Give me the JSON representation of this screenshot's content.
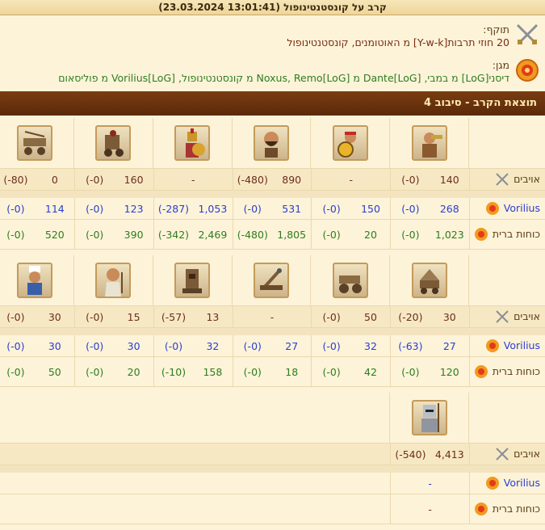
{
  "header": {
    "title": "קרב על קונסטנטינופול (13:01:41 23.03.2024)"
  },
  "attacker": {
    "role": "תוקף:",
    "text": "20 חוזי תרבות[Y-w-k] מ האוטומנים, קונסטנטינופול"
  },
  "defender": {
    "role": "מגן:",
    "text": "דיסני[LoG] מ במבי, Dante[LoG] מ Noxus, Remo[LoG] מ קונסטנטינופול, Vorilius[LoG] מ פוליסאום"
  },
  "section": {
    "title": "תוצאת הקרב - סיבוב 4"
  },
  "labels": {
    "enemies": "אויבים",
    "vorilius": "Vorilius",
    "allies": "כוחות ברית"
  },
  "icons": {
    "attacker": "crossed-swords-icon",
    "defender": "shield-emblem-icon",
    "enemy": "crossed-swords-icon",
    "ally": "shield-emblem-icon"
  },
  "colors": {
    "enemy_text": "#6b2e1c",
    "vorilius_text": "#2b3ed0",
    "ally_text": "#2e7d1e",
    "section_bar": "#6a3310"
  },
  "groups": [
    {
      "units": [
        {
          "name": "horn-soldier",
          "enemy": [
            "140",
            "(0-)"
          ],
          "vorilius": [
            "268",
            "(0-)"
          ],
          "allies": [
            "1,023",
            "(0-)"
          ]
        },
        {
          "name": "shield-warrior",
          "enemy": [
            "-"
          ],
          "vorilius": [
            "150",
            "(0-)"
          ],
          "allies": [
            "20",
            "(0-)"
          ]
        },
        {
          "name": "bearded-warrior",
          "enemy": [
            "890",
            "(480-)"
          ],
          "vorilius": [
            "531",
            "(0-)"
          ],
          "allies": [
            "1,805",
            "(480-)"
          ]
        },
        {
          "name": "spartan-hoplite",
          "enemy": [
            "-"
          ],
          "vorilius": [
            "1,053",
            "(287-)"
          ],
          "allies": [
            "2,469",
            "(342-)"
          ]
        },
        {
          "name": "armored-war-cart",
          "enemy": [
            "160",
            "(0-)"
          ],
          "vorilius": [
            "123",
            "(0-)"
          ],
          "allies": [
            "390",
            "(0-)"
          ]
        },
        {
          "name": "chariot-machine",
          "enemy": [
            "0",
            "(80-)"
          ],
          "vorilius": [
            "114",
            "(0-)"
          ],
          "allies": [
            "520",
            "(0-)"
          ]
        }
      ]
    },
    {
      "units": [
        {
          "name": "battering-ram",
          "enemy": [
            "30",
            "(20-)"
          ],
          "vorilius": [
            "27",
            "(63-)"
          ],
          "allies": [
            "120",
            "(0-)"
          ]
        },
        {
          "name": "siege-cannon",
          "enemy": [
            "50",
            "(0-)"
          ],
          "vorilius": [
            "32",
            "(0-)"
          ],
          "allies": [
            "42",
            "(0-)"
          ]
        },
        {
          "name": "catapult",
          "enemy": [
            "-"
          ],
          "vorilius": [
            "27",
            "(0-)"
          ],
          "allies": [
            "18",
            "(0-)"
          ]
        },
        {
          "name": "siege-tower",
          "enemy": [
            "13",
            "(57-)"
          ],
          "vorilius": [
            "32",
            "(0-)"
          ],
          "allies": [
            "158",
            "(10-)"
          ]
        },
        {
          "name": "old-scholar",
          "enemy": [
            "15",
            "(0-)"
          ],
          "vorilius": [
            "30",
            "(0-)"
          ],
          "allies": [
            "20",
            "(0-)"
          ]
        },
        {
          "name": "chef",
          "enemy": [
            "30",
            "(0-)"
          ],
          "vorilius": [
            "30",
            "(0-)"
          ],
          "allies": [
            "50",
            "(0-)"
          ]
        }
      ]
    },
    {
      "units": [
        {
          "name": "armored-knight",
          "enemy": [
            "4,413",
            "(540-)"
          ],
          "vorilius": [
            "-"
          ],
          "allies": [
            "-"
          ]
        }
      ]
    }
  ]
}
